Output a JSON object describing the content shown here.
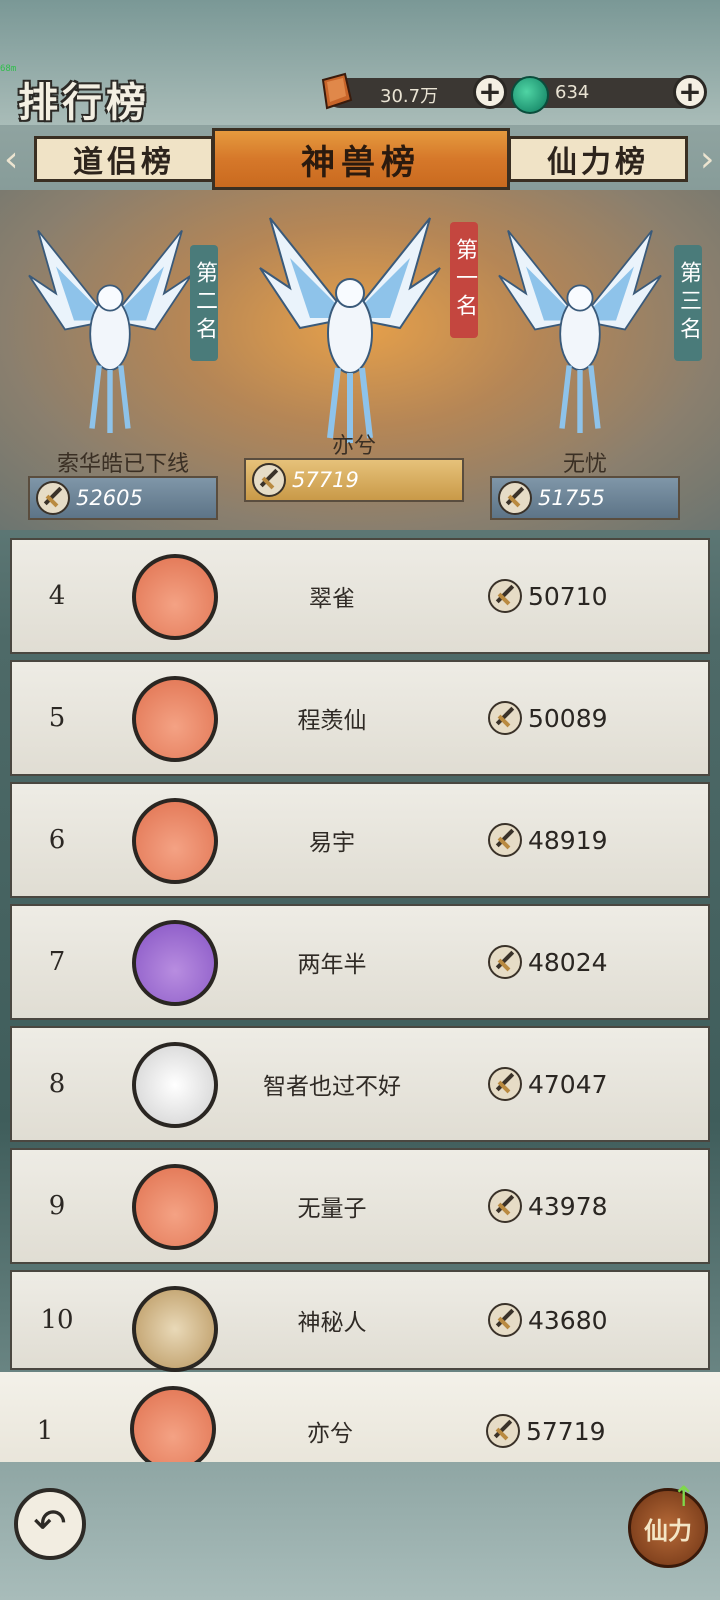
{
  "header": {
    "title": "排行榜",
    "fps": "68m",
    "copper": "30.7万",
    "jade": "634"
  },
  "tabs": [
    {
      "label": "道侣榜"
    },
    {
      "label": "神兽榜",
      "active": true
    },
    {
      "label": "仙力榜"
    }
  ],
  "podium": [
    {
      "place": "第一名",
      "name": "亦兮",
      "score": "57719"
    },
    {
      "place": "第二名",
      "name": "索华皓已下线",
      "score": "52605"
    },
    {
      "place": "第三名",
      "name": "无忧",
      "score": "51755"
    }
  ],
  "rows": [
    {
      "rank": "4",
      "name": "翠雀",
      "score": "50710",
      "avatar": "phoenix-orange"
    },
    {
      "rank": "5",
      "name": "程羡仙",
      "score": "50089",
      "avatar": "phoenix-orange"
    },
    {
      "rank": "6",
      "name": "易宇",
      "score": "48919",
      "avatar": "phoenix-orange"
    },
    {
      "rank": "7",
      "name": "两年半",
      "score": "48024",
      "avatar": "phoenix-purple"
    },
    {
      "rank": "8",
      "name": "智者也过不好",
      "score": "47047",
      "avatar": "white-tiger"
    },
    {
      "rank": "9",
      "name": "无量子",
      "score": "43978",
      "avatar": "phoenix-orange"
    },
    {
      "rank": "10",
      "name": "神秘人",
      "score": "43680",
      "avatar": "lion"
    }
  ],
  "self_row": {
    "rank": "1",
    "name": "亦兮",
    "score": "57719"
  },
  "footer": {
    "xianli_label": "仙力"
  }
}
